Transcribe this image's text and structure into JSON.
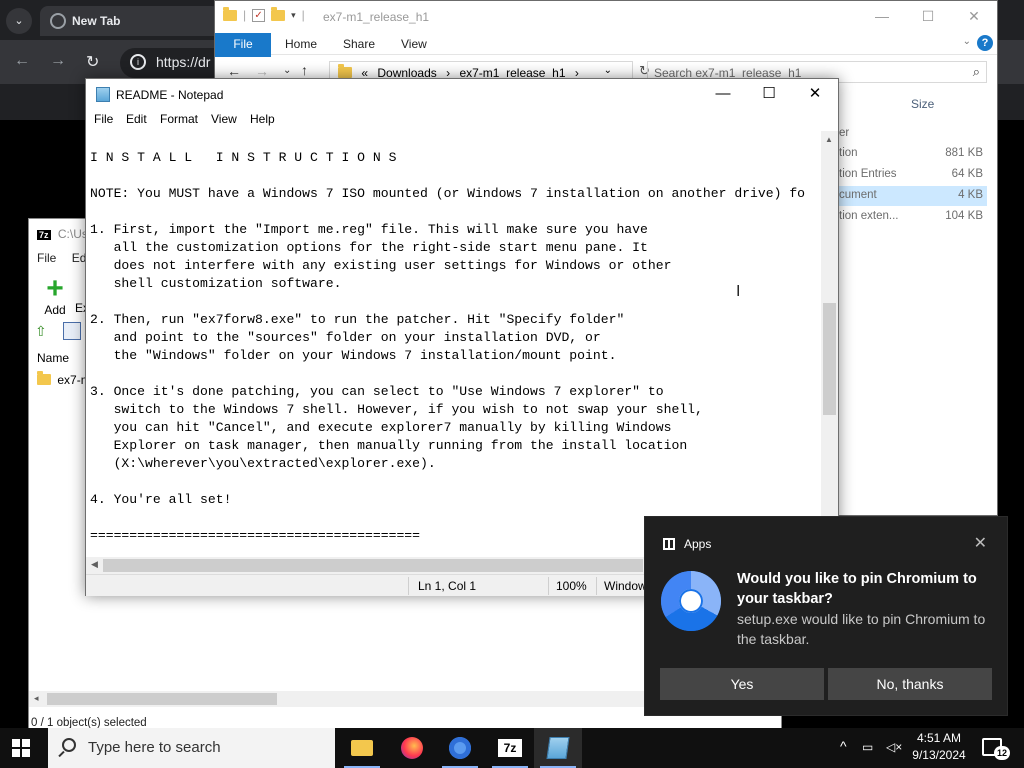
{
  "chrome": {
    "tab_title": "New Tab",
    "url": "https://dr"
  },
  "explorer": {
    "title": "ex7-m1_release_h1",
    "ribbon": {
      "file": "File",
      "home": "Home",
      "share": "Share",
      "view": "View"
    },
    "address": {
      "prefix": "«",
      "seg1": "Downloads",
      "sep": "›",
      "seg2": "ex7-m1_release_h1"
    },
    "search_placeholder": "Search ex7-m1_release_h1",
    "size_header": "Size",
    "type_header_partial": "er",
    "files": [
      {
        "type": "tion",
        "size": "881 KB"
      },
      {
        "type": "tion Entries",
        "size": "64 KB"
      },
      {
        "type": "cument",
        "size": "4 KB"
      },
      {
        "type": "tion exten...",
        "size": "104 KB"
      }
    ]
  },
  "sevenzip": {
    "title_partial": "C:\\Us",
    "logo": "7z",
    "menu": {
      "file": "File",
      "edit": "Edi"
    },
    "add_label": "Add",
    "extract_partial": "Ex",
    "name_header": "Name",
    "row_name": "ex7-m",
    "status": "0 / 1 object(s) selected"
  },
  "notepad": {
    "title": "README - Notepad",
    "menu": {
      "file": "File",
      "edit": "Edit",
      "format": "Format",
      "view": "View",
      "help": "Help"
    },
    "content": "I N S T A L L   I N S T R U C T I O N S\n\nNOTE: You MUST have a Windows 7 ISO mounted (or Windows 7 installation on another drive) fo\n\n1. First, import the \"Import me.reg\" file. This will make sure you have\n   all the customization options for the right-side start menu pane. It\n   does not interfere with any existing user settings for Windows or other\n   shell customization software.\n\n2. Then, run \"ex7forw8.exe\" to run the patcher. Hit \"Specify folder\"\n   and point to the \"sources\" folder on your installation DVD, or\n   the \"Windows\" folder on your Windows 7 installation/mount point.\n\n3. Once it's done patching, you can select to \"Use Windows 7 explorer\" to\n   switch to the Windows 7 shell. However, if you wish to not swap your shell,\n   you can hit \"Cancel\", and execute explorer7 manually by killing Windows\n   Explorer on task manager, then manually running from the install location\n   (X:\\wherever\\you\\extracted\\explorer.exe).\n\n4. You're all set!\n\n==========================================",
    "status": {
      "position": "Ln 1, Col 1",
      "zoom": "100%",
      "eol": "Window"
    }
  },
  "toast": {
    "app": "Apps",
    "title": "Would you like to pin Chromium to your taskbar?",
    "body": "setup.exe would like to pin Chromium to the taskbar.",
    "yes": "Yes",
    "no": "No, thanks"
  },
  "taskbar": {
    "search_placeholder": "Type here to search",
    "time": "4:51 AM",
    "date": "9/13/2024",
    "notifications": "12"
  },
  "colors": {
    "accent": "#1979ca",
    "toast_bg": "#1f1f1f",
    "taskbar_bg": "#101010"
  }
}
